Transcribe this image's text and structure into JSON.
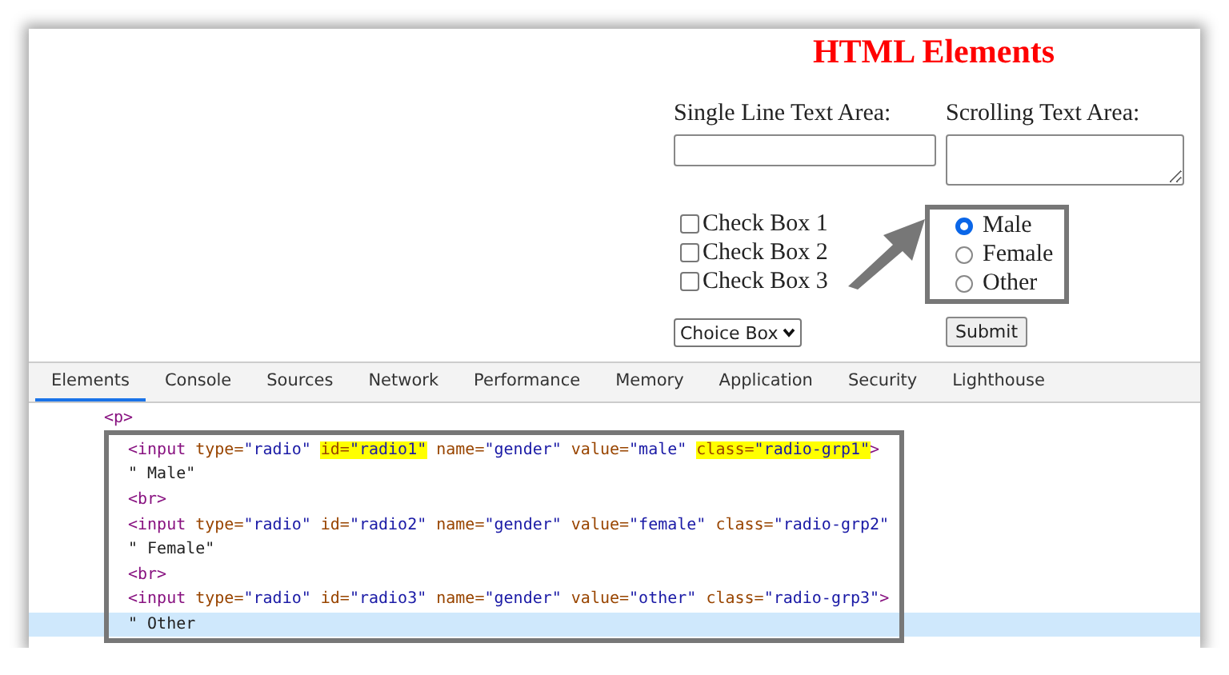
{
  "page": {
    "title": "HTML Elements",
    "single_line": {
      "label": "Single Line Text Area:"
    },
    "scrolling": {
      "label": "Scrolling Text Area:"
    },
    "checkboxes": [
      {
        "label": "Check Box 1",
        "checked": false
      },
      {
        "label": "Check Box 2",
        "checked": false
      },
      {
        "label": "Check Box 3",
        "checked": false
      }
    ],
    "radios": [
      {
        "label": "Male",
        "selected": true
      },
      {
        "label": "Female",
        "selected": false
      },
      {
        "label": "Other",
        "selected": false
      }
    ],
    "choice": {
      "value": "Choice Box"
    },
    "submit": "Submit"
  },
  "devtools": {
    "tabs": [
      {
        "label": "Elements",
        "selected": true
      },
      {
        "label": "Console",
        "selected": false
      },
      {
        "label": "Sources",
        "selected": false
      },
      {
        "label": "Network",
        "selected": false
      },
      {
        "label": "Performance",
        "selected": false
      },
      {
        "label": "Memory",
        "selected": false
      },
      {
        "label": "Application",
        "selected": false
      },
      {
        "label": "Security",
        "selected": false
      },
      {
        "label": "Lighthouse",
        "selected": false
      }
    ],
    "code": {
      "tag": "<p>",
      "children": [
        {
          "kind": "element",
          "selected": false,
          "open": "<input",
          "attrs": [
            {
              "name": "type=",
              "value": "\"radio\"",
              "highlighted": false
            },
            {
              "name": "id=",
              "value": "\"radio1\"",
              "highlighted": true
            },
            {
              "name": "name=",
              "value": "\"gender\"",
              "highlighted": false
            },
            {
              "name": "value=",
              "value": "\"male\"",
              "highlighted": false
            },
            {
              "name": "class=",
              "value": "\"radio-grp1\"",
              "highlighted": true
            }
          ],
          "close": ">"
        },
        {
          "kind": "text",
          "selected": false,
          "text": "\" Male\""
        },
        {
          "kind": "tag",
          "selected": false,
          "text": "<br>"
        },
        {
          "kind": "element",
          "selected": false,
          "open": "<input",
          "attrs": [
            {
              "name": "type=",
              "value": "\"radio\"",
              "highlighted": false
            },
            {
              "name": "id=",
              "value": "\"radio2\"",
              "highlighted": false
            },
            {
              "name": "name=",
              "value": "\"gender\"",
              "highlighted": false
            },
            {
              "name": "value=",
              "value": "\"female\"",
              "highlighted": false
            },
            {
              "name": "class=",
              "value": "\"radio-grp2\"",
              "highlighted": false
            }
          ]
        },
        {
          "kind": "text",
          "selected": false,
          "text": "\" Female\""
        },
        {
          "kind": "tag",
          "selected": false,
          "text": "<br>"
        },
        {
          "kind": "element",
          "selected": false,
          "open": "<input",
          "attrs": [
            {
              "name": "type=",
              "value": "\"radio\"",
              "highlighted": false
            },
            {
              "name": "id=",
              "value": "\"radio3\"",
              "highlighted": false
            },
            {
              "name": "name=",
              "value": "\"gender\"",
              "highlighted": false
            },
            {
              "name": "value=",
              "value": "\"other\"",
              "highlighted": false
            },
            {
              "name": "class=",
              "value": "\"radio-grp3\"",
              "highlighted": false
            }
          ],
          "close": ">"
        },
        {
          "kind": "text",
          "selected": true,
          "text": "\" Other"
        }
      ]
    }
  }
}
